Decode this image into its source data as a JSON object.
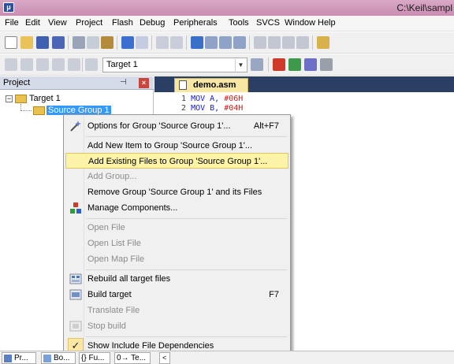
{
  "window": {
    "title": "C:\\Keil\\sampl"
  },
  "menubar": {
    "items": [
      "File",
      "Edit",
      "View",
      "Project",
      "Flash",
      "Debug",
      "Peripherals",
      "Tools",
      "SVCS",
      "Window",
      "Help"
    ]
  },
  "toolbar": {
    "target_combo_value": "Target 1"
  },
  "project_panel": {
    "title": "Project",
    "tree": {
      "target": "Target 1",
      "group": "Source Group 1"
    }
  },
  "editor": {
    "tab_label": "demo.asm",
    "lines": [
      {
        "num": "1",
        "op": "MOV",
        "reg": "A,",
        "val": "#06H"
      },
      {
        "num": "2",
        "op": "MOV",
        "reg": "B,",
        "val": "#04H"
      }
    ]
  },
  "context_menu": {
    "items": [
      {
        "label": "Options for Group 'Source Group 1'...",
        "shortcut": "Alt+F7",
        "icon": "options-wand-icon",
        "enabled": true
      },
      {
        "label": "Add New  Item to Group 'Source Group 1'...",
        "enabled": true
      },
      {
        "label": "Add Existing Files to Group 'Source Group 1'...",
        "enabled": true,
        "highlighted": true
      },
      {
        "label": "Add Group...",
        "enabled": false
      },
      {
        "label": "Remove Group 'Source Group 1' and its Files",
        "enabled": true
      },
      {
        "label": "Manage Components...",
        "icon": "manage-components-icon",
        "enabled": true
      },
      {
        "label": "Open File",
        "enabled": false
      },
      {
        "label": "Open List File",
        "enabled": false
      },
      {
        "label": "Open Map File",
        "enabled": false
      },
      {
        "label": "Rebuild all target files",
        "icon": "rebuild-icon",
        "enabled": true
      },
      {
        "label": "Build target",
        "shortcut": "F7",
        "icon": "build-icon",
        "enabled": true
      },
      {
        "label": "Translate File",
        "enabled": false
      },
      {
        "label": "Stop build",
        "icon": "stop-build-icon",
        "enabled": false
      },
      {
        "label": "Show Include File Dependencies",
        "checked": true,
        "enabled": true
      }
    ]
  },
  "bottom_tabs": [
    "Pr...",
    "Bo...",
    "{} Fu...",
    "0→ Te..."
  ],
  "colors": {
    "titlebar": "#c98db2",
    "highlight": "#fdf3a8",
    "selection": "#3399ff",
    "tab_strip": "#2b3e63",
    "keyword": "#1a1ad6",
    "number": "#d81818"
  }
}
